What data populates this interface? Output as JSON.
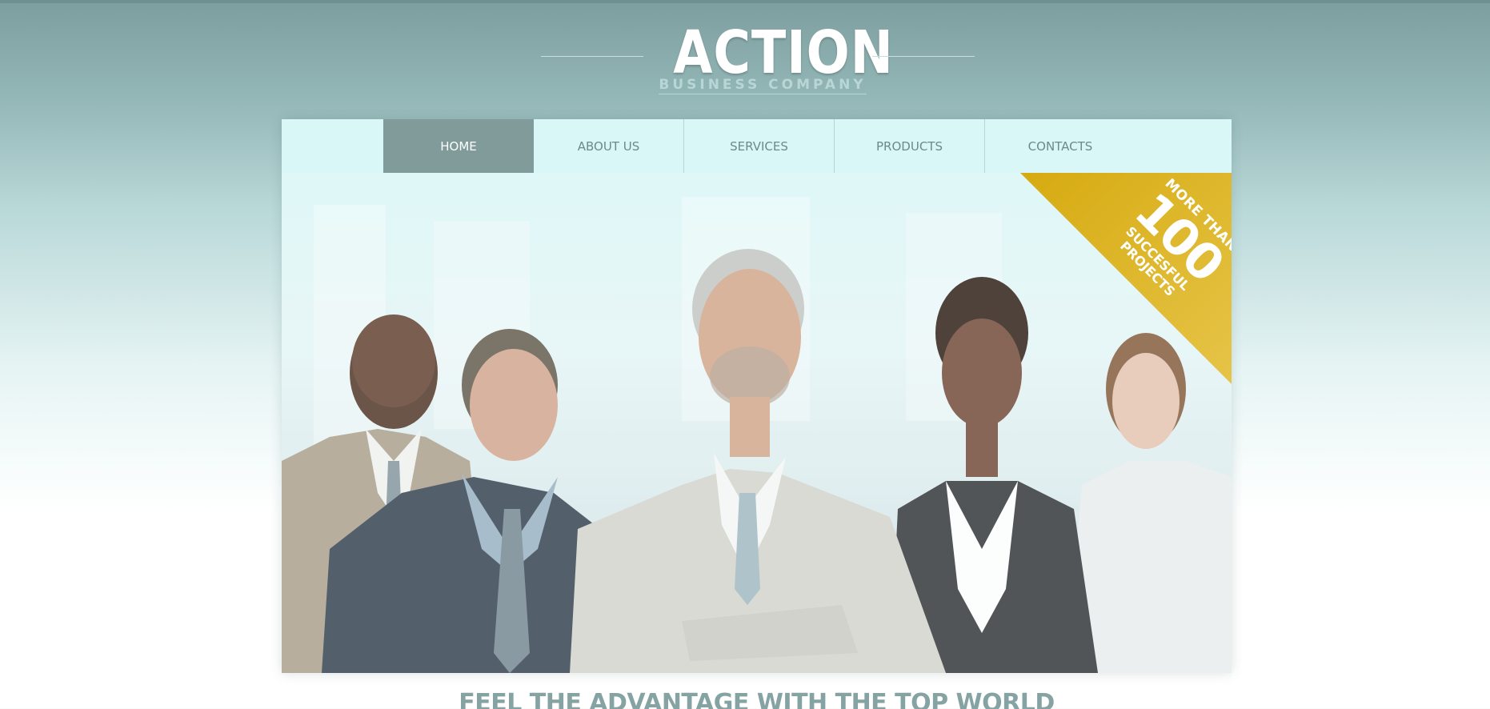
{
  "logo": {
    "title": "ACTION",
    "subtitle": "BUSINESS COMPANY"
  },
  "nav": {
    "items": [
      {
        "label": "HOME",
        "active": true
      },
      {
        "label": "ABOUT US",
        "active": false
      },
      {
        "label": "SERVICES",
        "active": false
      },
      {
        "label": "PRODUCTS",
        "active": false
      },
      {
        "label": "CONTACTS",
        "active": false
      }
    ]
  },
  "badge": {
    "line1": "MORE THAN",
    "number": "100",
    "line3": "SUCCESFUL",
    "line4": "PROJECTS"
  },
  "hero": {
    "image_alt": "business team photo"
  },
  "headline": {
    "text": "FEEL THE ADVANTAGE WITH THE TOP WORLD"
  },
  "colors": {
    "accent_gold": "#d6aa10",
    "nav_active": "#819a9a",
    "nav_text": "#6c8a8a",
    "headline": "#86a3a3"
  }
}
